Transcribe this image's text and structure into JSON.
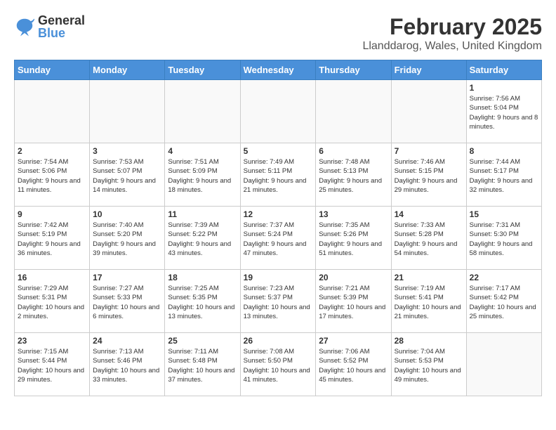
{
  "header": {
    "logo_general": "General",
    "logo_blue": "Blue",
    "title": "February 2025",
    "subtitle": "Llanddarog, Wales, United Kingdom"
  },
  "days_of_week": [
    "Sunday",
    "Monday",
    "Tuesday",
    "Wednesday",
    "Thursday",
    "Friday",
    "Saturday"
  ],
  "weeks": [
    [
      {
        "day": "",
        "info": ""
      },
      {
        "day": "",
        "info": ""
      },
      {
        "day": "",
        "info": ""
      },
      {
        "day": "",
        "info": ""
      },
      {
        "day": "",
        "info": ""
      },
      {
        "day": "",
        "info": ""
      },
      {
        "day": "1",
        "info": "Sunrise: 7:56 AM\nSunset: 5:04 PM\nDaylight: 9 hours and 8 minutes."
      }
    ],
    [
      {
        "day": "2",
        "info": "Sunrise: 7:54 AM\nSunset: 5:06 PM\nDaylight: 9 hours and 11 minutes."
      },
      {
        "day": "3",
        "info": "Sunrise: 7:53 AM\nSunset: 5:07 PM\nDaylight: 9 hours and 14 minutes."
      },
      {
        "day": "4",
        "info": "Sunrise: 7:51 AM\nSunset: 5:09 PM\nDaylight: 9 hours and 18 minutes."
      },
      {
        "day": "5",
        "info": "Sunrise: 7:49 AM\nSunset: 5:11 PM\nDaylight: 9 hours and 21 minutes."
      },
      {
        "day": "6",
        "info": "Sunrise: 7:48 AM\nSunset: 5:13 PM\nDaylight: 9 hours and 25 minutes."
      },
      {
        "day": "7",
        "info": "Sunrise: 7:46 AM\nSunset: 5:15 PM\nDaylight: 9 hours and 29 minutes."
      },
      {
        "day": "8",
        "info": "Sunrise: 7:44 AM\nSunset: 5:17 PM\nDaylight: 9 hours and 32 minutes."
      }
    ],
    [
      {
        "day": "9",
        "info": "Sunrise: 7:42 AM\nSunset: 5:19 PM\nDaylight: 9 hours and 36 minutes."
      },
      {
        "day": "10",
        "info": "Sunrise: 7:40 AM\nSunset: 5:20 PM\nDaylight: 9 hours and 39 minutes."
      },
      {
        "day": "11",
        "info": "Sunrise: 7:39 AM\nSunset: 5:22 PM\nDaylight: 9 hours and 43 minutes."
      },
      {
        "day": "12",
        "info": "Sunrise: 7:37 AM\nSunset: 5:24 PM\nDaylight: 9 hours and 47 minutes."
      },
      {
        "day": "13",
        "info": "Sunrise: 7:35 AM\nSunset: 5:26 PM\nDaylight: 9 hours and 51 minutes."
      },
      {
        "day": "14",
        "info": "Sunrise: 7:33 AM\nSunset: 5:28 PM\nDaylight: 9 hours and 54 minutes."
      },
      {
        "day": "15",
        "info": "Sunrise: 7:31 AM\nSunset: 5:30 PM\nDaylight: 9 hours and 58 minutes."
      }
    ],
    [
      {
        "day": "16",
        "info": "Sunrise: 7:29 AM\nSunset: 5:31 PM\nDaylight: 10 hours and 2 minutes."
      },
      {
        "day": "17",
        "info": "Sunrise: 7:27 AM\nSunset: 5:33 PM\nDaylight: 10 hours and 6 minutes."
      },
      {
        "day": "18",
        "info": "Sunrise: 7:25 AM\nSunset: 5:35 PM\nDaylight: 10 hours and 13 minutes."
      },
      {
        "day": "19",
        "info": "Sunrise: 7:23 AM\nSunset: 5:37 PM\nDaylight: 10 hours and 13 minutes."
      },
      {
        "day": "20",
        "info": "Sunrise: 7:21 AM\nSunset: 5:39 PM\nDaylight: 10 hours and 17 minutes."
      },
      {
        "day": "21",
        "info": "Sunrise: 7:19 AM\nSunset: 5:41 PM\nDaylight: 10 hours and 21 minutes."
      },
      {
        "day": "22",
        "info": "Sunrise: 7:17 AM\nSunset: 5:42 PM\nDaylight: 10 hours and 25 minutes."
      }
    ],
    [
      {
        "day": "23",
        "info": "Sunrise: 7:15 AM\nSunset: 5:44 PM\nDaylight: 10 hours and 29 minutes."
      },
      {
        "day": "24",
        "info": "Sunrise: 7:13 AM\nSunset: 5:46 PM\nDaylight: 10 hours and 33 minutes."
      },
      {
        "day": "25",
        "info": "Sunrise: 7:11 AM\nSunset: 5:48 PM\nDaylight: 10 hours and 37 minutes."
      },
      {
        "day": "26",
        "info": "Sunrise: 7:08 AM\nSunset: 5:50 PM\nDaylight: 10 hours and 41 minutes."
      },
      {
        "day": "27",
        "info": "Sunrise: 7:06 AM\nSunset: 5:52 PM\nDaylight: 10 hours and 45 minutes."
      },
      {
        "day": "28",
        "info": "Sunrise: 7:04 AM\nSunset: 5:53 PM\nDaylight: 10 hours and 49 minutes."
      },
      {
        "day": "",
        "info": ""
      }
    ]
  ]
}
